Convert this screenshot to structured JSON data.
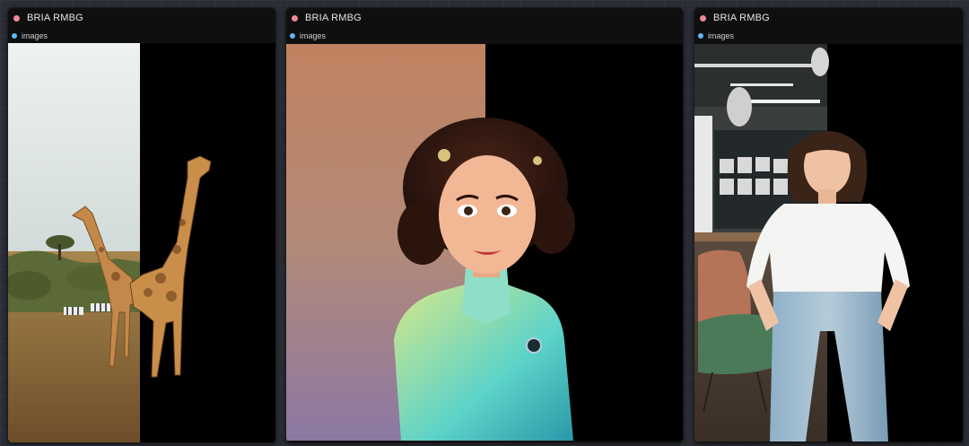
{
  "nodes": [
    {
      "title": "BRIA RMBG",
      "output_label": "images",
      "status_color": "#f08896",
      "output_color": "#64b5f6"
    },
    {
      "title": "BRIA RMBG",
      "output_label": "images",
      "status_color": "#f08896",
      "output_color": "#64b5f6"
    },
    {
      "title": "BRIA RMBG",
      "output_label": "images",
      "status_color": "#f08896",
      "output_color": "#64b5f6"
    }
  ],
  "previews": [
    {
      "subject": "giraffes-savanna-before-after"
    },
    {
      "subject": "cartoon-woman-portrait-before-after"
    },
    {
      "subject": "woman-office-before-after"
    }
  ]
}
